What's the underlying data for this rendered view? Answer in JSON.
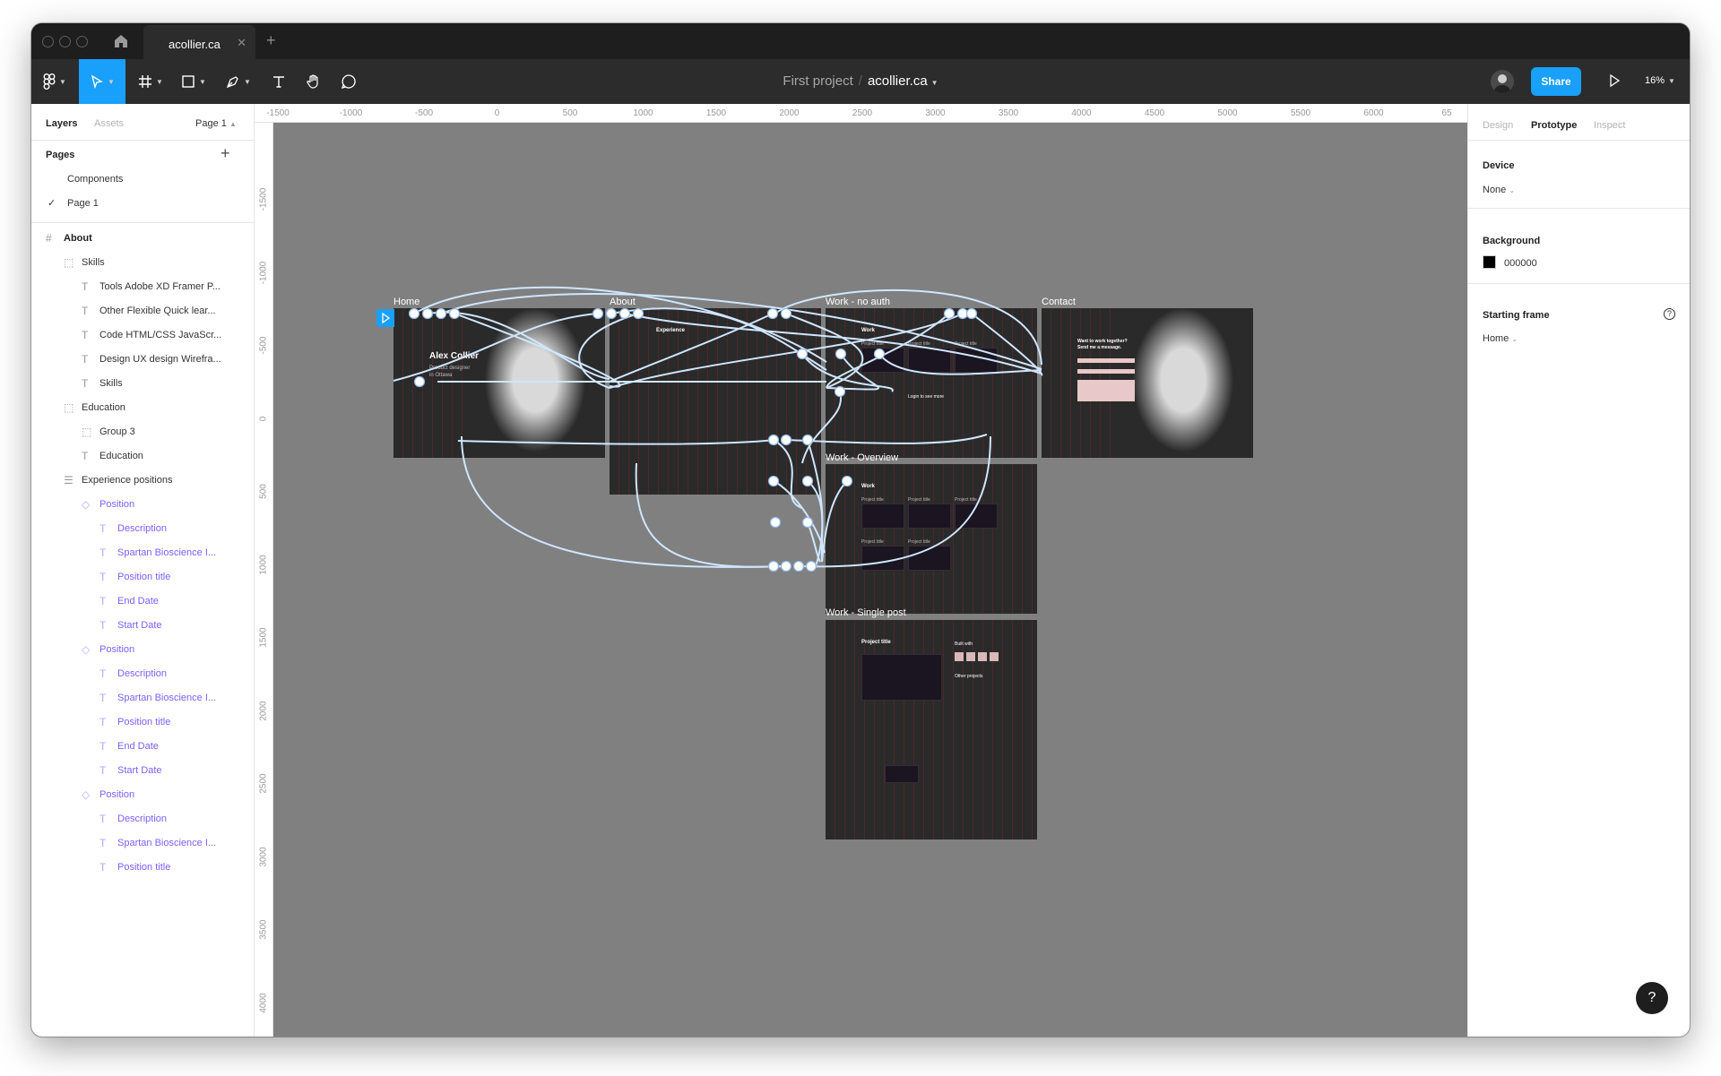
{
  "tab": {
    "title": "acollier.ca"
  },
  "toolbar": {
    "project": "First project",
    "file": "acollier.ca",
    "share_label": "Share",
    "zoom": "16%"
  },
  "left_panel": {
    "tabs": [
      "Layers",
      "Assets"
    ],
    "page_selector": "Page 1",
    "pages_title": "Pages",
    "pages": [
      "Components",
      "Page 1"
    ],
    "layers": [
      "About",
      "Skills",
      "Tools Adobe XD Framer P...",
      "Other Flexible Quick lear...",
      "Code HTML/CSS JavaScr...",
      "Design UX design Wirefra...",
      "Skills",
      "Education",
      "Group 3",
      "Education",
      "Experience positions",
      "Position",
      "Description",
      "Spartan Bioscience I...",
      "Position title",
      "End Date",
      "Start Date",
      "Position",
      "Description",
      "Spartan Bioscience I...",
      "Position title",
      "End Date",
      "Start Date",
      "Position",
      "Description",
      "Spartan Bioscience I...",
      "Position title"
    ]
  },
  "ruler": {
    "top": [
      "-1500",
      "-1000",
      "-500",
      "0",
      "500",
      "1000",
      "1500",
      "2000",
      "2500",
      "3000",
      "3500",
      "4000",
      "4500",
      "5000",
      "5500",
      "6000",
      "65"
    ],
    "left": [
      "-1500",
      "-1000",
      "-500",
      "0",
      "500",
      "1000",
      "1500",
      "2000",
      "2500",
      "3000",
      "3500",
      "4000"
    ]
  },
  "canvas": {
    "background": "#808080",
    "frames": {
      "home": {
        "label": "Home",
        "name": "Alex Collier",
        "sub1": "Product designer",
        "sub2": "in Ottawa"
      },
      "about": {
        "label": "About",
        "heading": "Experience"
      },
      "work_no_auth": {
        "label": "Work - no auth",
        "heading": "Work",
        "t1": "Project title",
        "t2": "Project title",
        "t3": "Project title",
        "login": "Login to see more"
      },
      "contact": {
        "label": "Contact",
        "line1": "Want to work together?",
        "line2": "Send me a message."
      },
      "work_overview": {
        "label": "Work - Overview",
        "heading": "Work",
        "t1": "Project title",
        "t2": "Project title",
        "t3": "Project title",
        "t4": "Project title",
        "t5": "Project title"
      },
      "work_single": {
        "label": "Work - Single post",
        "heading": "Project title",
        "built": "Built with",
        "other": "Other projects"
      }
    }
  },
  "right_panel": {
    "tabs": [
      "Design",
      "Prototype",
      "Inspect"
    ],
    "device_title": "Device",
    "device_value": "None",
    "background_title": "Background",
    "background_value": "000000",
    "starting_frame_title": "Starting frame",
    "starting_frame_value": "Home"
  },
  "help": "?"
}
